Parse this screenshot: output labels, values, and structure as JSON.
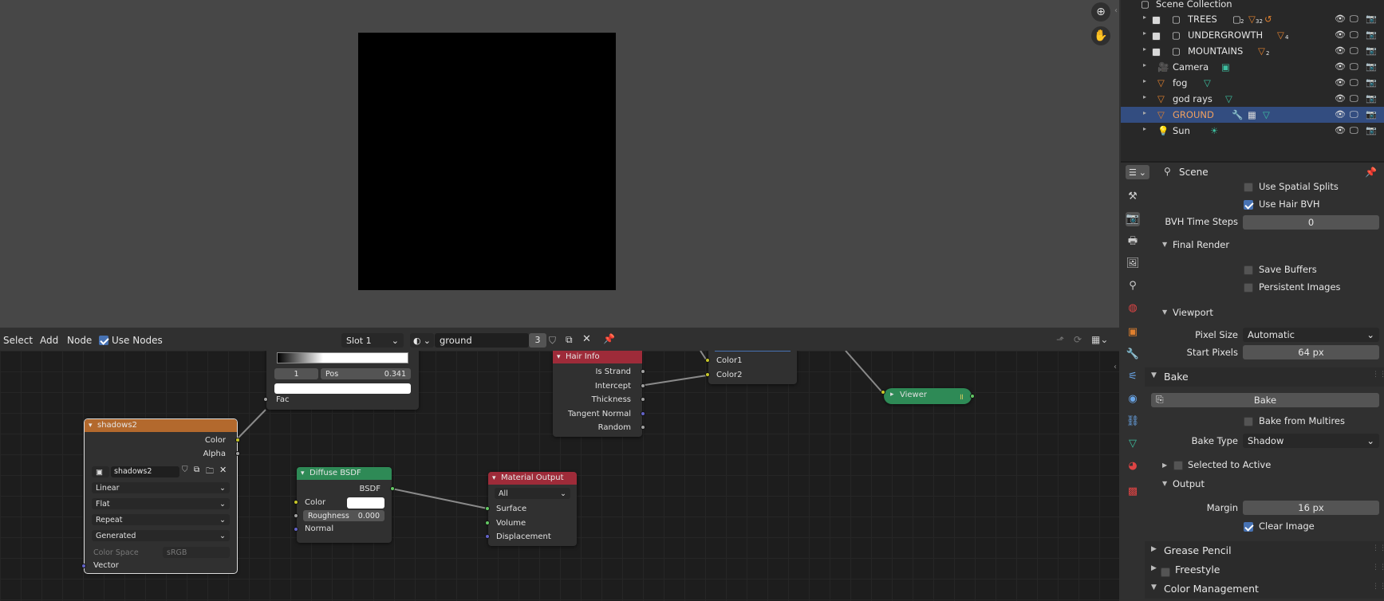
{
  "viewport": {
    "zoom_icon": "zoom-icon",
    "pan_icon": "hand-icon"
  },
  "node_editor": {
    "menu": {
      "select": "Select",
      "add": "Add",
      "node": "Node",
      "use_nodes": "Use Nodes"
    },
    "slot": "Slot 1",
    "material_name": "ground",
    "users": "3"
  },
  "nodes": {
    "color_ramp": {
      "index": "1",
      "pos_label": "Pos",
      "pos_value": "0.341",
      "fac": "Fac"
    },
    "shadows2": {
      "title": "shadows2",
      "out_color": "Color",
      "out_alpha": "Alpha",
      "image_name": "shadows2",
      "interp": "Linear",
      "projection": "Flat",
      "extension": "Repeat",
      "source": "Generated",
      "color_space_label": "Color Space",
      "color_space": "sRGB",
      "vector": "Vector"
    },
    "hair_info": {
      "title": "Hair Info",
      "outputs": [
        "Is Strand",
        "Intercept",
        "Thickness",
        "Tangent Normal",
        "Random"
      ]
    },
    "mix": {
      "color1": "Color1",
      "color2": "Color2"
    },
    "viewer": {
      "title": "Viewer"
    },
    "diffuse": {
      "title": "Diffuse BSDF",
      "out": "BSDF",
      "color": "Color",
      "roughness_label": "Roughness",
      "roughness": "0.000",
      "normal": "Normal"
    },
    "material_output": {
      "title": "Material Output",
      "target": "All",
      "surface": "Surface",
      "volume": "Volume",
      "displacement": "Displacement"
    }
  },
  "outliner": {
    "title": "Scene Collection",
    "items": [
      {
        "label": "TREES",
        "badge1": "2",
        "badge2": "32"
      },
      {
        "label": "UNDERGROWTH",
        "badge1": "4"
      },
      {
        "label": "MOUNTAINS",
        "badge1": "2"
      },
      {
        "label": "Camera"
      },
      {
        "label": "fog"
      },
      {
        "label": "god rays"
      },
      {
        "label": "GROUND"
      },
      {
        "label": "Sun"
      }
    ]
  },
  "properties": {
    "context": "Scene",
    "use_spatial_splits": "Use Spatial Splits",
    "use_hair_bvh": "Use Hair BVH",
    "bvh_time_steps_label": "BVH Time Steps",
    "bvh_time_steps": "0",
    "final_render": "Final Render",
    "save_buffers": "Save Buffers",
    "persistent_images": "Persistent Images",
    "viewport": "Viewport",
    "pixel_size_label": "Pixel Size",
    "pixel_size": "Automatic",
    "start_pixels_label": "Start Pixels",
    "start_pixels": "64 px",
    "bake_section": "Bake",
    "bake_button": "Bake",
    "bake_from_multires": "Bake from Multires",
    "bake_type_label": "Bake Type",
    "bake_type": "Shadow",
    "selected_to_active": "Selected to Active",
    "output": "Output",
    "margin_label": "Margin",
    "margin": "16 px",
    "clear_image": "Clear Image",
    "grease_pencil": "Grease Pencil",
    "freestyle": "Freestyle",
    "color_management": "Color Management"
  },
  "colors": {
    "accent": "#4772b3",
    "image_node": "#b3692d",
    "shader_node": "#2e8a56",
    "output_node": "#9e2b39",
    "selected_row": "#334d80",
    "object_orange": "#e0802e"
  }
}
